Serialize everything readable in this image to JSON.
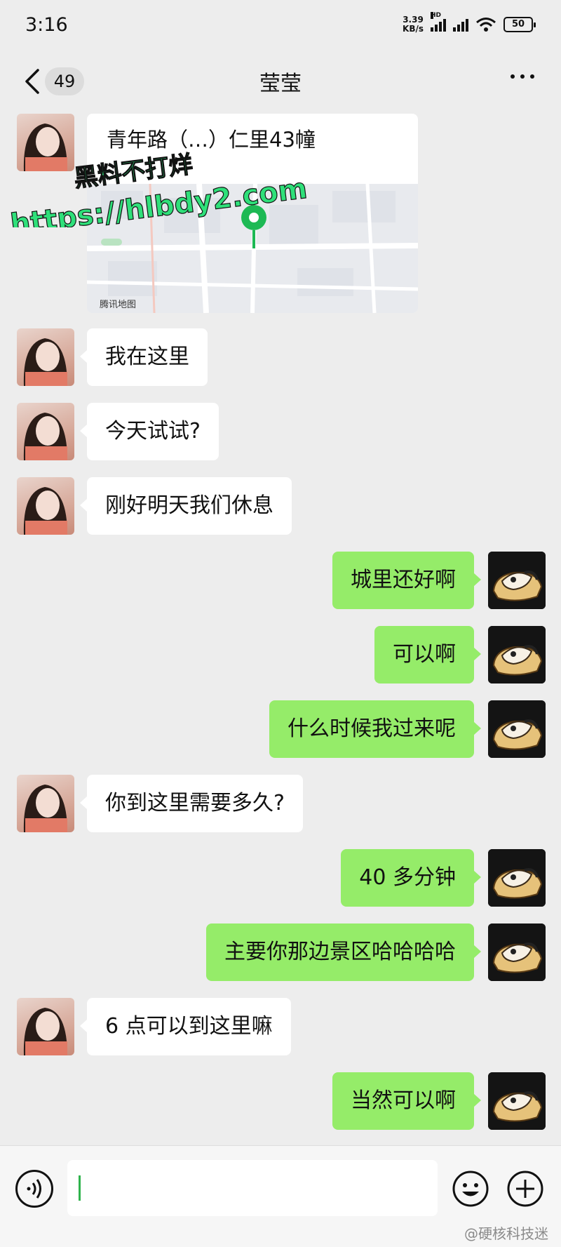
{
  "status_bar": {
    "time": "3:16",
    "net_speed_value": "3.39",
    "net_speed_unit": "KB/s",
    "hd_label": "HD",
    "battery": "50"
  },
  "nav": {
    "unread_count": "49",
    "title": "莹莹"
  },
  "location_card": {
    "address": "青年路（…）仁里43幢",
    "map_attribution": "腾讯地图"
  },
  "watermark": {
    "line1": "黑料不打烊",
    "line2": "https://hlbdy2.com"
  },
  "messages": [
    {
      "side": "in",
      "text": "我在这里"
    },
    {
      "side": "in",
      "text": "今天试试?"
    },
    {
      "side": "in",
      "text": "刚好明天我们休息"
    },
    {
      "side": "out",
      "text": "城里还好啊"
    },
    {
      "side": "out",
      "text": "可以啊"
    },
    {
      "side": "out",
      "text": "什么时候我过来呢"
    },
    {
      "side": "in",
      "text": "你到这里需要多久?"
    },
    {
      "side": "out",
      "text": "40 多分钟"
    },
    {
      "side": "out",
      "text": "主要你那边景区哈哈哈哈"
    },
    {
      "side": "in",
      "text": "6 点可以到这里嘛"
    },
    {
      "side": "out",
      "text": "当然可以啊"
    }
  ],
  "input_bar": {
    "value": ""
  },
  "credit": "@硬核科技迷",
  "colors": {
    "background": "#ededed",
    "outgoing_bubble": "#95ec69",
    "incoming_bubble": "#ffffff",
    "watermark_text": "#2fe07a",
    "map_pin": "#1db954"
  },
  "icons": [
    "back-icon",
    "more-icon",
    "voice-icon",
    "emoji-icon",
    "plus-icon",
    "location-pin-icon",
    "avatar-girl",
    "avatar-bread"
  ]
}
